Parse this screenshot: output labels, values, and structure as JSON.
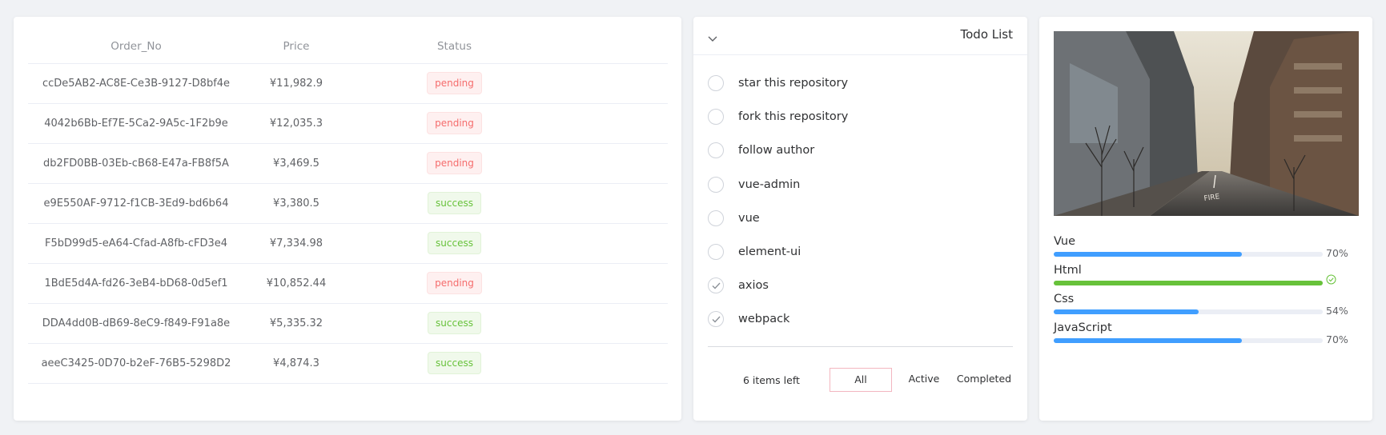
{
  "orders": {
    "columns": [
      "Order_No",
      "Price",
      "Status"
    ],
    "rows": [
      {
        "order_no": "ccDe5AB2-AC8E-Ce3B-9127-D8bf4e",
        "price": "¥11,982.9",
        "status": "pending"
      },
      {
        "order_no": "4042b6Bb-Ef7E-5Ca2-9A5c-1F2b9e",
        "price": "¥12,035.3",
        "status": "pending"
      },
      {
        "order_no": "db2FD0BB-03Eb-cB68-E47a-FB8f5A",
        "price": "¥3,469.5",
        "status": "pending"
      },
      {
        "order_no": "e9E550AF-9712-f1CB-3Ed9-bd6b64",
        "price": "¥3,380.5",
        "status": "success"
      },
      {
        "order_no": "F5bD99d5-eA64-Cfad-A8fb-cFD3e4",
        "price": "¥7,334.98",
        "status": "success"
      },
      {
        "order_no": "1BdE5d4A-fd26-3eB4-bD68-0d5ef1",
        "price": "¥10,852.44",
        "status": "pending"
      },
      {
        "order_no": "DDA4dd0B-dB69-8eC9-f849-F91a8e",
        "price": "¥5,335.32",
        "status": "success"
      },
      {
        "order_no": "aeeC3425-0D70-b2eF-76B5-5298D2",
        "price": "¥4,874.3",
        "status": "success"
      }
    ]
  },
  "todo": {
    "title": "Todo List",
    "items": [
      {
        "label": "star this repository",
        "done": false
      },
      {
        "label": "fork this repository",
        "done": false
      },
      {
        "label": "follow author",
        "done": false
      },
      {
        "label": "vue-admin",
        "done": false
      },
      {
        "label": "vue",
        "done": false
      },
      {
        "label": "element-ui",
        "done": false
      },
      {
        "label": "axios",
        "done": true
      },
      {
        "label": "webpack",
        "done": true
      }
    ],
    "footer": {
      "count": "6 items left",
      "filters": [
        "All",
        "Active",
        "Completed"
      ],
      "selected": "All"
    }
  },
  "skills": {
    "items": [
      {
        "name": "Vue",
        "percent": 70,
        "pct_label": "70%",
        "color": "#409eff"
      },
      {
        "name": "Html",
        "percent": 100,
        "pct_label": "",
        "color": "#67c23a",
        "complete": true
      },
      {
        "name": "Css",
        "percent": 54,
        "pct_label": "54%",
        "color": "#409eff"
      },
      {
        "name": "JavaScript",
        "percent": 70,
        "pct_label": "70%",
        "color": "#409eff"
      }
    ]
  },
  "colors": {
    "primary": "#409eff",
    "success": "#67c23a",
    "danger": "#f56c6c"
  }
}
